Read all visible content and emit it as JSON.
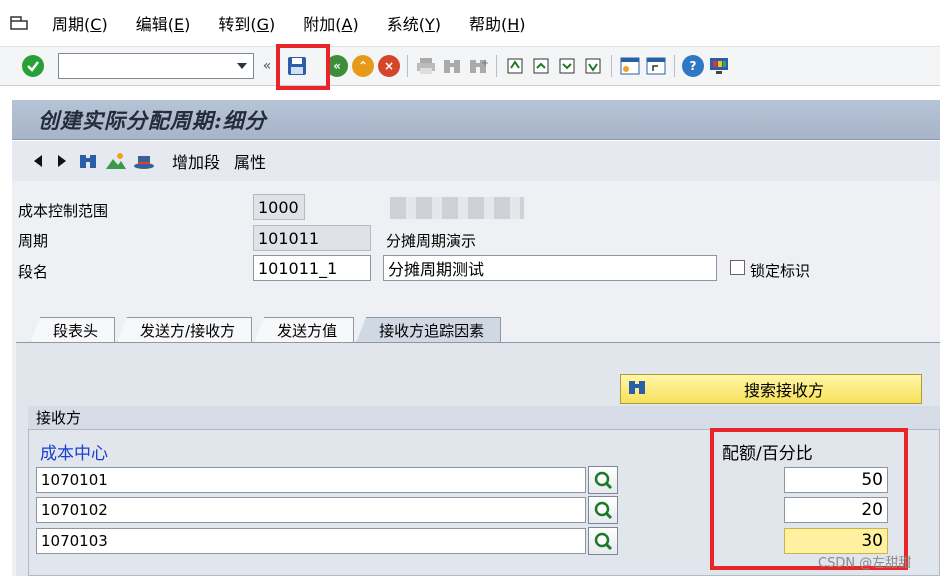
{
  "menu": [
    {
      "label": "周期",
      "key": "C"
    },
    {
      "label": "编辑",
      "key": "E"
    },
    {
      "label": "转到",
      "key": "G"
    },
    {
      "label": "附加",
      "key": "A"
    },
    {
      "label": "系统",
      "key": "Y"
    },
    {
      "label": "帮助",
      "key": "H"
    }
  ],
  "toolbar": {
    "command_value": ""
  },
  "title": "创建实际分配周期:细分",
  "app_toolbar": {
    "add_segment": "增加段",
    "attributes": "属性"
  },
  "header": {
    "controlling_area_label": "成本控制范围",
    "controlling_area_value": "1000",
    "cycle_label": "周期",
    "cycle_value": "101011",
    "cycle_text": "分摊周期演示",
    "segment_label": "段名",
    "segment_value": "101011_1",
    "segment_text": "分摊周期测试",
    "lock_label": "锁定标识"
  },
  "tabs": [
    {
      "label": "段表头",
      "active": false
    },
    {
      "label": "发送方/接收方",
      "active": false
    },
    {
      "label": "发送方值",
      "active": false
    },
    {
      "label": "接收方追踪因素",
      "active": true
    }
  ],
  "search_button": "搜索接收方",
  "receiver_group": {
    "title": "接收方",
    "col_cost_center": "成本中心",
    "col_percent": "配额/百分比",
    "rows": [
      {
        "cost_center": "1070101",
        "percent": "50"
      },
      {
        "cost_center": "1070102",
        "percent": "20"
      },
      {
        "cost_center": "1070103",
        "percent": "30"
      }
    ]
  },
  "watermark": "CSDN @左甜甜",
  "colors": {
    "accent_red": "#e8262a",
    "title_bg": "#b7c3d6",
    "button_yellow": "#f7e15a",
    "link_blue": "#1a3fd1"
  }
}
